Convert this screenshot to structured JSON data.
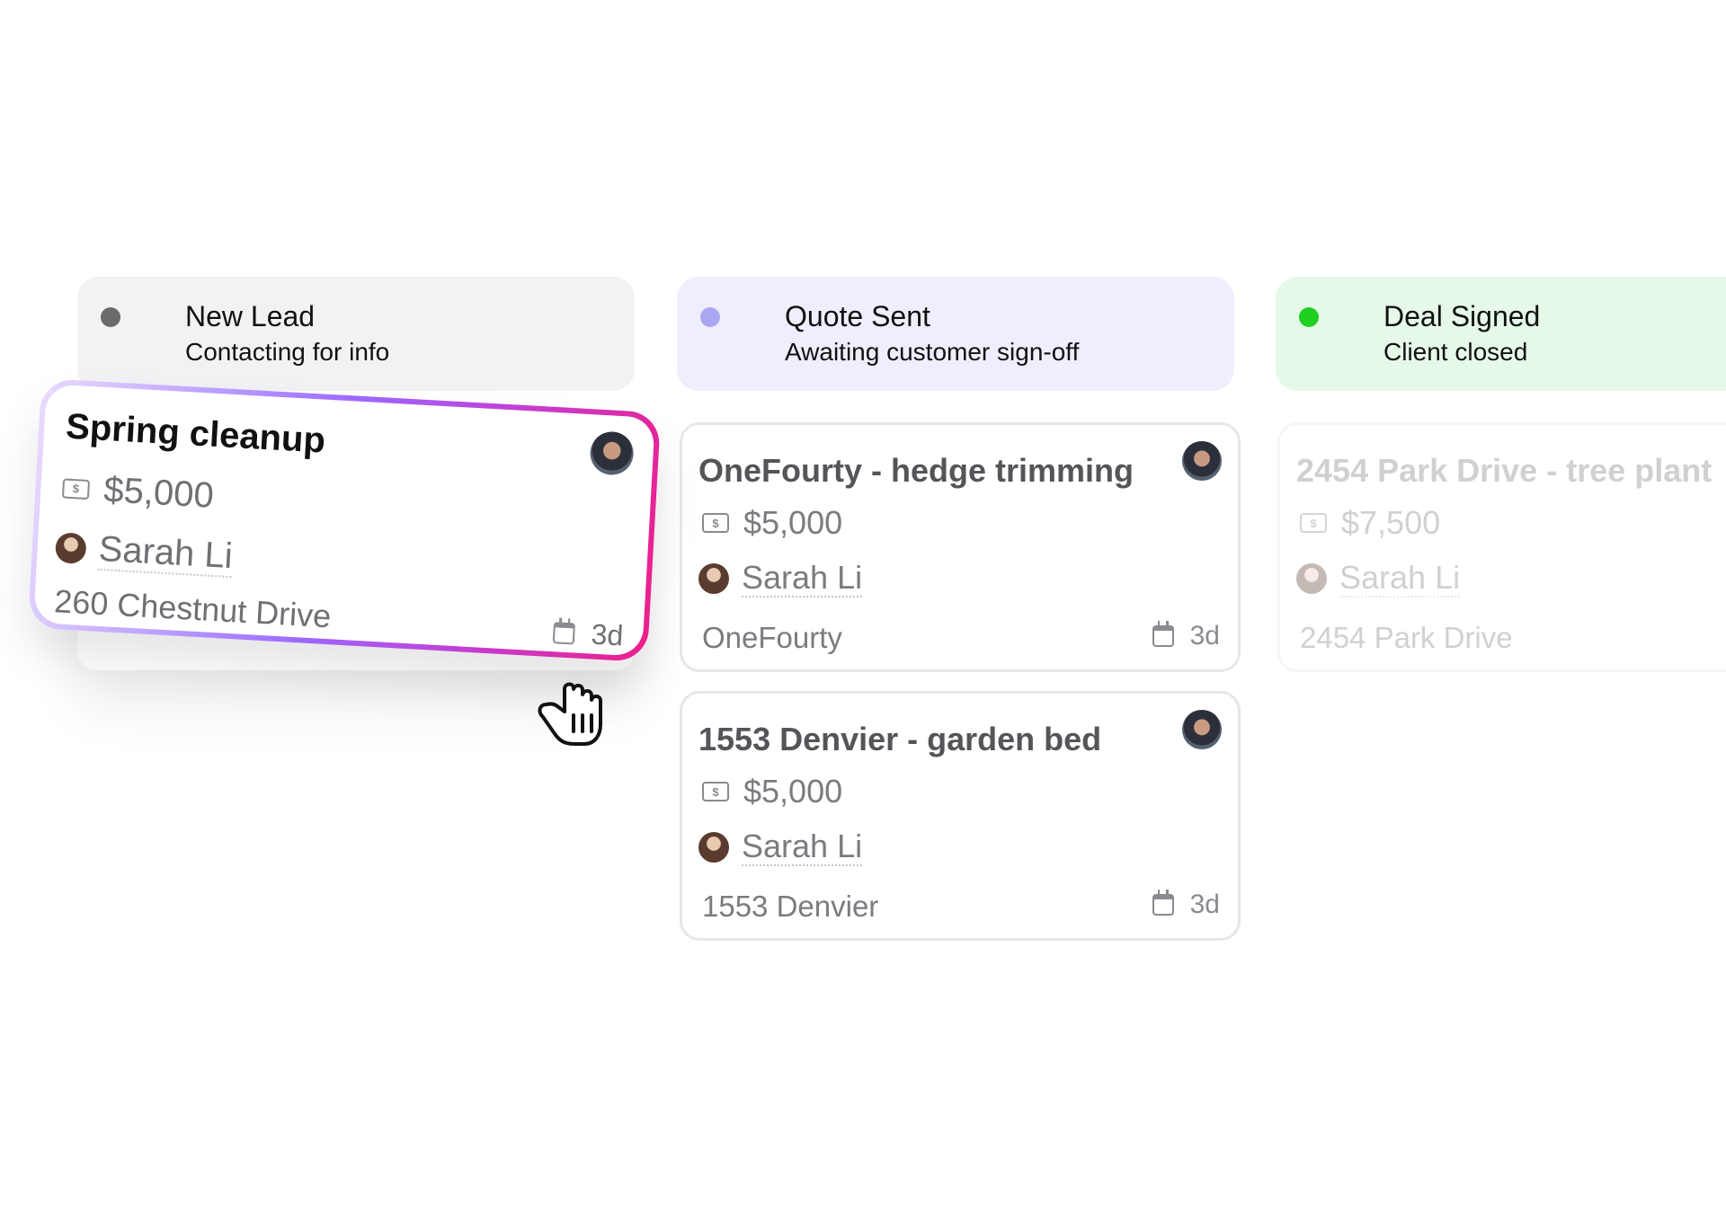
{
  "columns": [
    {
      "title": "New Lead",
      "subtitle": "Contacting for info",
      "dot_color": "#6b6b6e",
      "bg_color": "#f1f2f4"
    },
    {
      "title": "Quote Sent",
      "subtitle": "Awaiting customer sign-off",
      "dot_color": "#a9a7f2",
      "bg_color": "#eeeefc"
    },
    {
      "title": "Deal Signed",
      "subtitle": "Client closed",
      "dot_color": "#1fd11f",
      "bg_color": "#e6f9e9"
    }
  ],
  "dragged_card": {
    "title": "Spring cleanup",
    "amount": "$5,000",
    "assignee": "Sarah Li",
    "address": "260 Chestnut Drive",
    "due": "3d",
    "border_gradient": [
      "#e9dcff",
      "#9d67ff",
      "#ee1e8a"
    ]
  },
  "quote_cards": [
    {
      "title": "OneFourty - hedge trimming",
      "amount": "$5,000",
      "assignee": "Sarah Li",
      "address": "OneFourty",
      "due": "3d"
    },
    {
      "title": "1553 Denvier - garden bed",
      "amount": "$5,000",
      "assignee": "Sarah Li",
      "address": "1553 Denvier",
      "due": "3d"
    }
  ],
  "deal_cards": [
    {
      "title": "2454 Park Drive - tree plant",
      "amount": "$7,500",
      "assignee": "Sarah Li",
      "address": "2454 Park Drive"
    }
  ],
  "icons": {
    "money": "money-icon",
    "calendar": "calendar-icon",
    "cursor": "grab-hand-icon"
  }
}
